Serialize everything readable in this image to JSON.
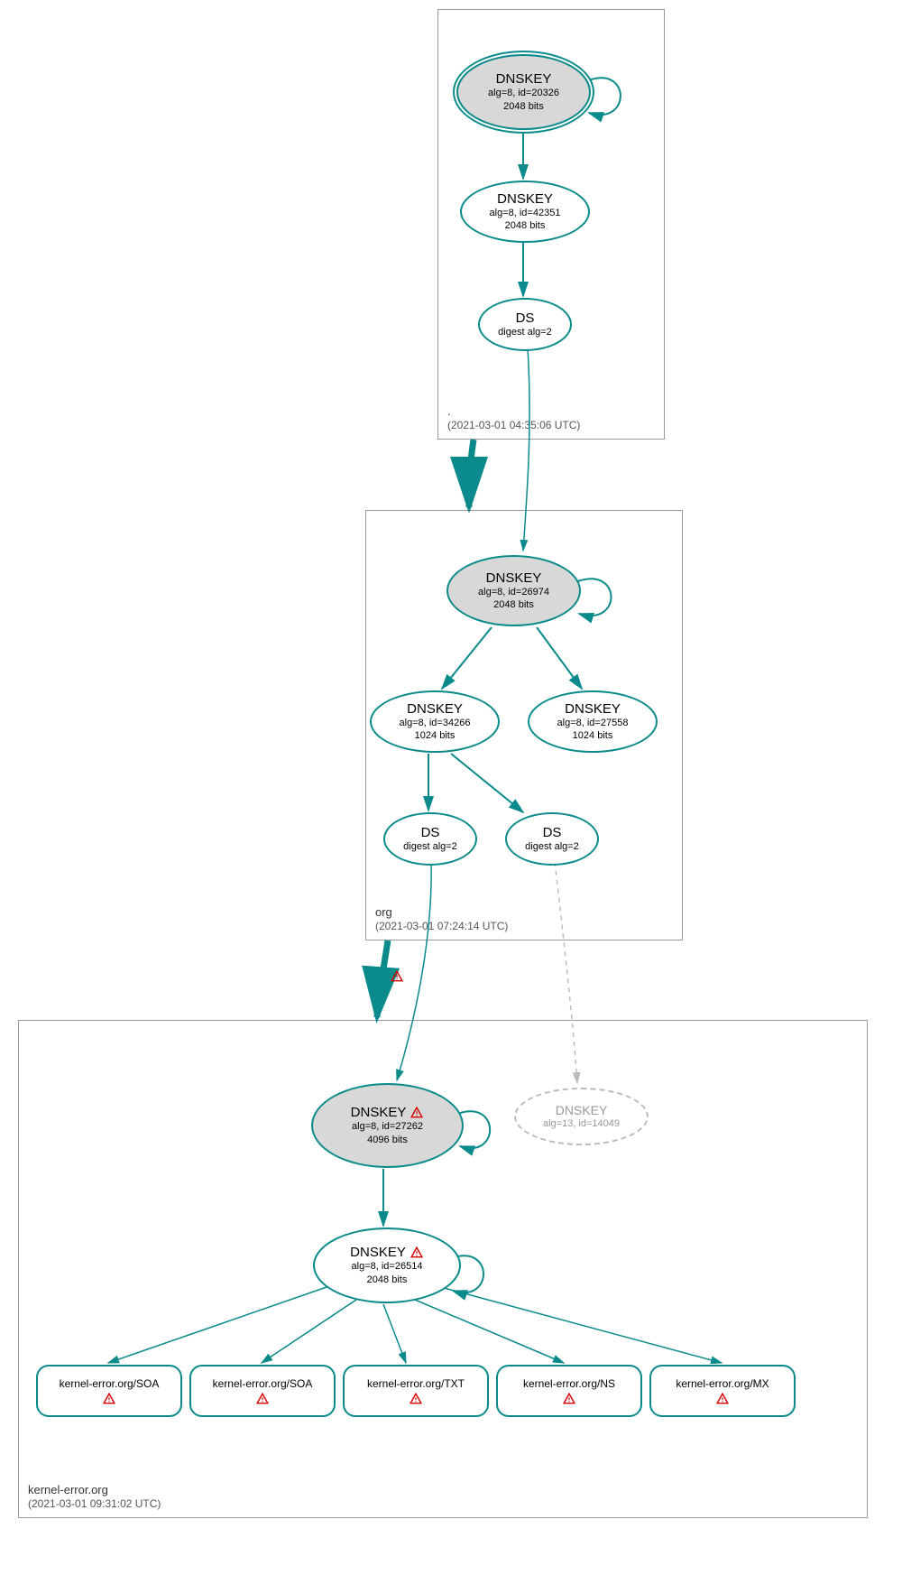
{
  "zones": {
    "root": {
      "label": ".",
      "timestamp": "(2021-03-01 04:35:06 UTC)"
    },
    "org": {
      "label": "org",
      "timestamp": "(2021-03-01 07:24:14 UTC)"
    },
    "domain": {
      "label": "kernel-error.org",
      "timestamp": "(2021-03-01 09:31:02 UTC)"
    }
  },
  "nodes": {
    "root_ksk": {
      "title": "DNSKEY",
      "line1": "alg=8, id=20326",
      "line2": "2048 bits"
    },
    "root_zsk": {
      "title": "DNSKEY",
      "line1": "alg=8, id=42351",
      "line2": "2048 bits"
    },
    "root_ds": {
      "title": "DS",
      "line1": "digest alg=2"
    },
    "org_ksk": {
      "title": "DNSKEY",
      "line1": "alg=8, id=26974",
      "line2": "2048 bits"
    },
    "org_zsk1": {
      "title": "DNSKEY",
      "line1": "alg=8, id=34266",
      "line2": "1024 bits"
    },
    "org_zsk2": {
      "title": "DNSKEY",
      "line1": "alg=8, id=27558",
      "line2": "1024 bits"
    },
    "org_ds1": {
      "title": "DS",
      "line1": "digest alg=2"
    },
    "org_ds2": {
      "title": "DS",
      "line1": "digest alg=2"
    },
    "dom_ksk": {
      "title": "DNSKEY",
      "line1": "alg=8, id=27262",
      "line2": "4096 bits"
    },
    "dom_ghost": {
      "title": "DNSKEY",
      "line1": "alg=13, id=14049"
    },
    "dom_zsk": {
      "title": "DNSKEY",
      "line1": "alg=8, id=26514",
      "line2": "2048 bits"
    },
    "rr_soa1": {
      "label": "kernel-error.org/SOA"
    },
    "rr_soa2": {
      "label": "kernel-error.org/SOA"
    },
    "rr_txt": {
      "label": "kernel-error.org/TXT"
    },
    "rr_ns": {
      "label": "kernel-error.org/NS"
    },
    "rr_mx": {
      "label": "kernel-error.org/MX"
    }
  }
}
